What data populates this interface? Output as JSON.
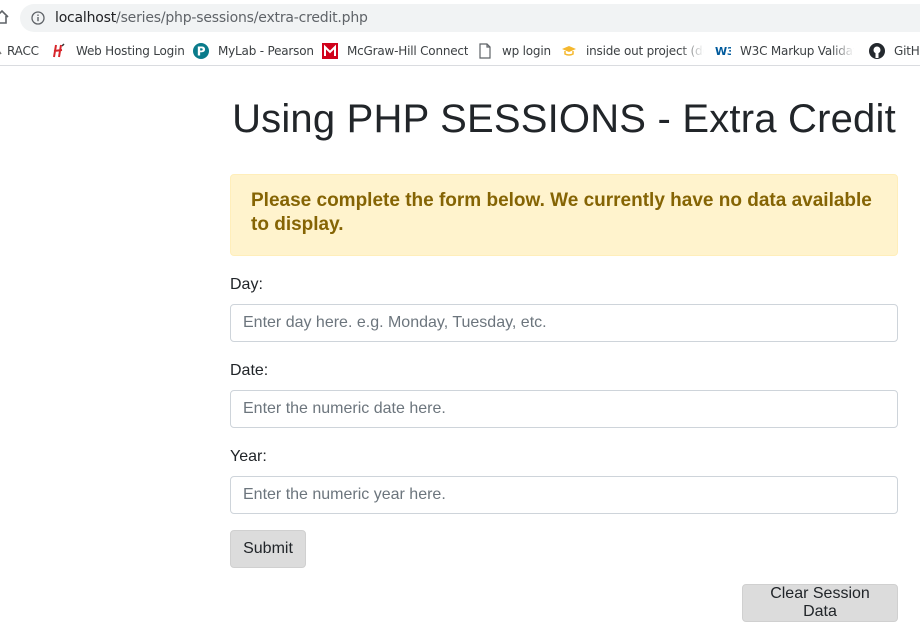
{
  "browser": {
    "url_host": "localhost",
    "url_path": "/series/php-sessions/extra-credit.php",
    "bookmarks": [
      {
        "label": "RACC",
        "icon": "partial-icon"
      },
      {
        "label": "Web Hosting Login",
        "icon": "hostinger-icon"
      },
      {
        "label": "MyLab - Pearson",
        "icon": "pearson-icon"
      },
      {
        "label": "McGraw-Hill Connect",
        "icon": "mcgraw-hill-icon"
      },
      {
        "label": "wp login",
        "icon": "document-icon"
      },
      {
        "label": "inside out project (de",
        "icon": "graduation-cap-icon"
      },
      {
        "label": "W3C Markup Validati",
        "icon": "w3c-icon"
      },
      {
        "label": "GitH",
        "icon": "github-icon"
      }
    ]
  },
  "page": {
    "title": "Using PHP SESSIONS - Extra Credit",
    "alert": "Please complete the form below. We currently have no data available to display.",
    "form": {
      "day_label": "Day:",
      "day_placeholder": "Enter day here. e.g. Monday, Tuesday, etc.",
      "date_label": "Date:",
      "date_placeholder": "Enter the numeric date here.",
      "year_label": "Year:",
      "year_placeholder": "Enter the numeric year here.",
      "submit_label": "Submit"
    },
    "clear_label": "Clear Session Data"
  },
  "colors": {
    "alert_bg": "#fff3cd",
    "alert_text": "#856404",
    "button_bg": "#dcdcdc",
    "omnibox_bg": "#f1f3f4"
  }
}
